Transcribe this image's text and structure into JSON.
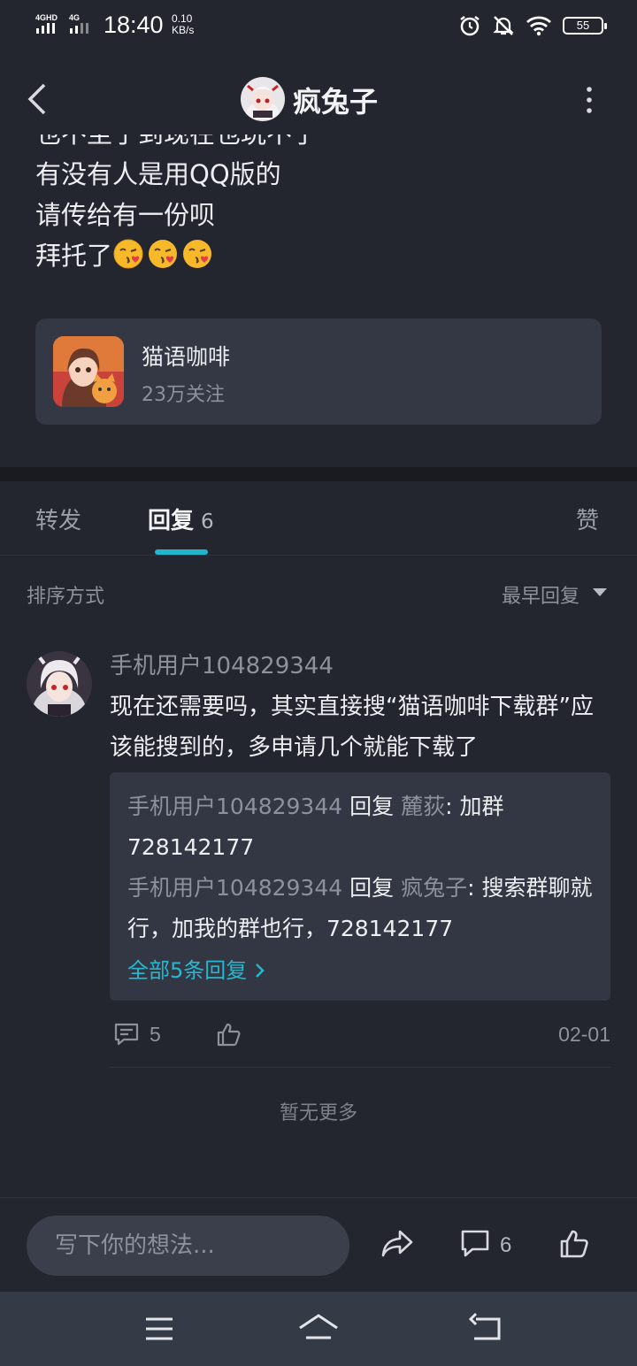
{
  "status_bar": {
    "network": "4GHD 4G",
    "time": "18:40",
    "speed_value": "0.10",
    "speed_unit": "KB/s",
    "battery": "55"
  },
  "header": {
    "title": "疯兔子"
  },
  "post": {
    "clipped_line": "也不至于到现在也玩不了",
    "lines": [
      "有没有人是用QQ版的",
      "请传给有一份呗",
      "拜托了"
    ],
    "emoji": "kissing-face-emoji"
  },
  "forum": {
    "name": "猫语咖啡",
    "followers": "23万关注"
  },
  "tabs": {
    "forward": "转发",
    "reply": "回复",
    "reply_count": "6",
    "like": "赞"
  },
  "sort": {
    "label": "排序方式",
    "value": "最早回复"
  },
  "comment": {
    "user": "手机用户104829344",
    "text": "现在还需要吗，其实直接搜“猫语咖啡下载群”应该能搜到的，多申请几个就能下载了",
    "sub_replies": [
      {
        "user": "手机用户104829344",
        "verb": "回复",
        "target": "麓荻",
        "text": ": 加群728142177"
      },
      {
        "user": "手机用户104829344",
        "verb": "回复",
        "target": "疯兔子",
        "text": ": 搜索群聊就行，加我的群也行，728142177"
      }
    ],
    "more_replies": "全部5条回复",
    "reply_count": "5",
    "date": "02-01"
  },
  "no_more": "暂无更多",
  "bottom": {
    "placeholder": "写下你的想法...",
    "comment_count": "6"
  },
  "colors": {
    "background": "#23262f",
    "accent": "#20b6cc",
    "card": "#343844"
  }
}
